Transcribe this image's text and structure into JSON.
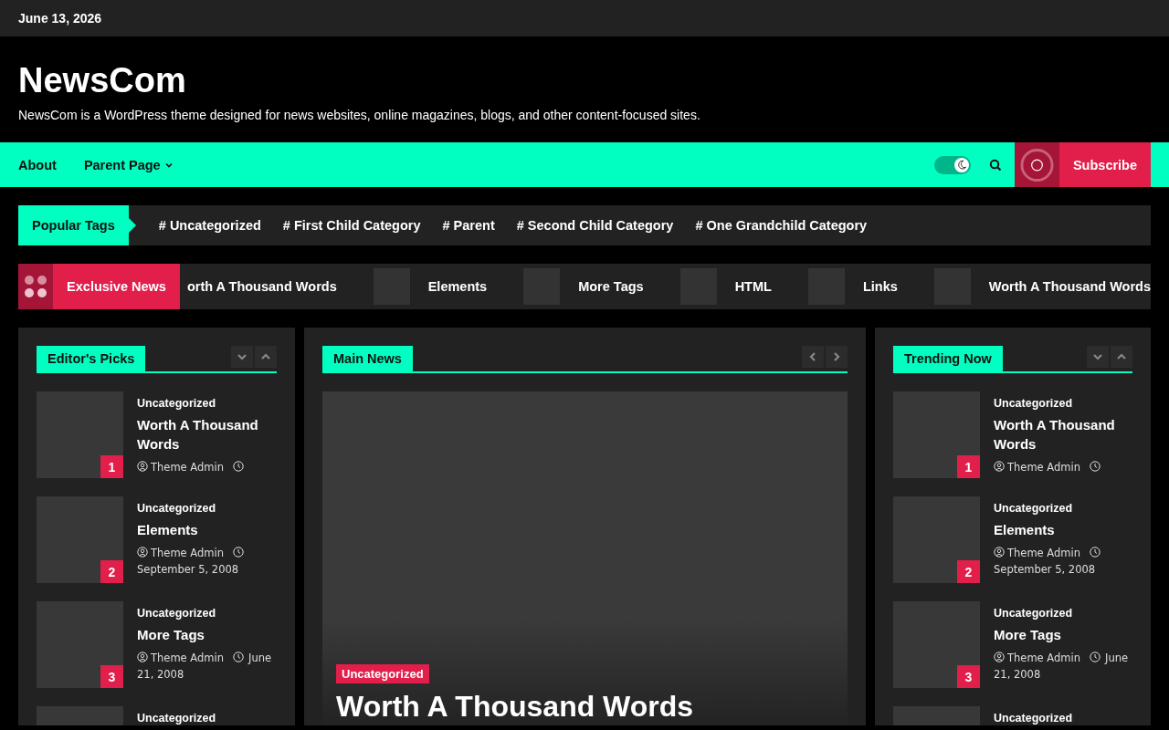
{
  "top_bar": {
    "date": "June 13, 2026"
  },
  "header": {
    "site_title": "NewsCom",
    "tagline": "NewsCom is a WordPress theme designed for news websites, online magazines, blogs, and other content-focused sites."
  },
  "nav": {
    "items": [
      {
        "label": "About",
        "has_submenu": false
      },
      {
        "label": "Parent Page",
        "has_submenu": true
      }
    ],
    "dark_mode": true,
    "subscribe": "Subscribe"
  },
  "popular_tags": {
    "title": "Popular Tags",
    "tags": [
      {
        "hash": "#",
        "label": "Uncategorized"
      },
      {
        "hash": "#",
        "label": "First Child Category"
      },
      {
        "hash": "#",
        "label": "Parent"
      },
      {
        "hash": "#",
        "label": "Second Child Category"
      },
      {
        "hash": "#",
        "label": "One Grandchild Category"
      }
    ]
  },
  "ticker": {
    "title": "Exclusive News",
    "items": [
      {
        "title": "orth A Thousand Words",
        "thumbnail": false
      },
      {
        "title": "Elements",
        "thumbnail": true
      },
      {
        "title": "More Tags",
        "thumbnail": true
      },
      {
        "title": "HTML",
        "thumbnail": true
      },
      {
        "title": "Links",
        "thumbnail": true
      },
      {
        "title": "Worth A Thousand Words",
        "thumbnail": true
      }
    ]
  },
  "editors_picks": {
    "title": "Editor's Picks",
    "posts": [
      {
        "rank": "1",
        "category": "Uncategorized",
        "title": "Worth A Thousand Words",
        "author": "Theme Admin"
      },
      {
        "rank": "2",
        "category": "Uncategorized",
        "title": "Elements",
        "author": "Theme Admin",
        "date": "September 5, 2008"
      },
      {
        "rank": "3",
        "category": "Uncategorized",
        "title": "More Tags",
        "author": "Theme Admin",
        "date": "June 21, 2008"
      },
      {
        "category": "Uncategorized"
      }
    ]
  },
  "main_news": {
    "title": "Main News",
    "slide": {
      "category": "Uncategorized",
      "title": "Worth A Thousand Words"
    }
  },
  "trending_now": {
    "title": "Trending Now",
    "posts": [
      {
        "rank": "1",
        "category": "Uncategorized",
        "title": "Worth A Thousand Words",
        "author": "Theme Admin"
      },
      {
        "rank": "2",
        "category": "Uncategorized",
        "title": "Elements",
        "author": "Theme Admin",
        "date": "September 5, 2008"
      },
      {
        "rank": "3",
        "category": "Uncategorized",
        "title": "More Tags",
        "author": "Theme Admin",
        "date": "June 21, 2008"
      },
      {
        "category": "Uncategorized"
      }
    ]
  }
}
